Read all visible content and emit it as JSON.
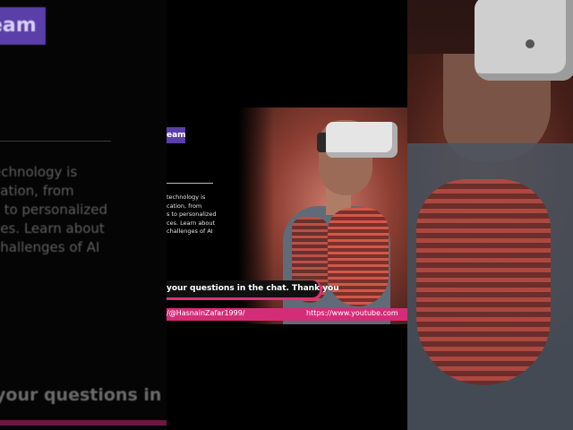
{
  "backdrop_left": {
    "badge_text": "eam",
    "description": "echnology is\ncation, from\ns to personalized\nces. Learn about\nchallenges of AI",
    "questions_text": "your questions in t"
  },
  "thumbnail": {
    "badge_text": "eam",
    "description": "technology is\ncation, from\ns to personalized\nces. Learn about\nchallenges of AI",
    "questions_text": "your questions in the chat. Thank you",
    "link_left": "/@HasnainZafar1999/",
    "link_right": "https://www.youtube.com"
  },
  "colors": {
    "badge_purple": "#5a3fa8",
    "link_pink": "#d42d78"
  }
}
